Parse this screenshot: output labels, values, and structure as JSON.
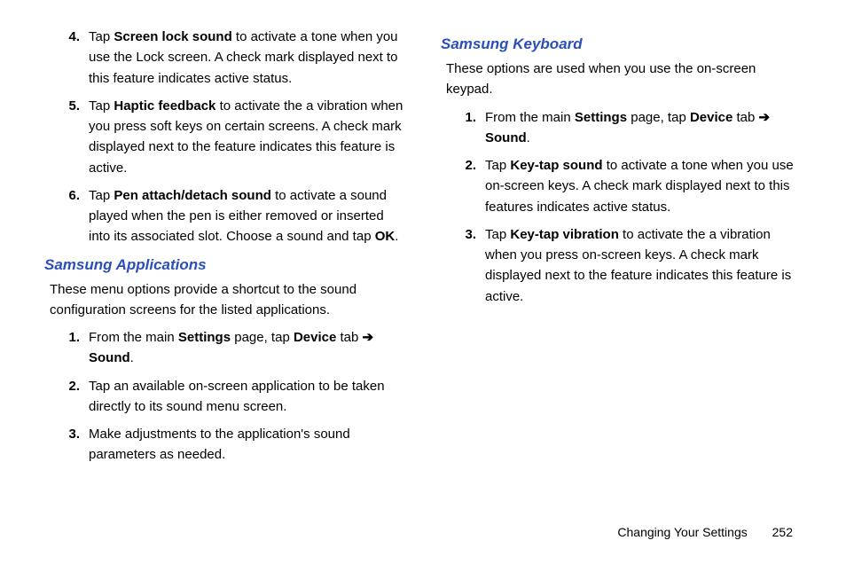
{
  "col1": {
    "items_a": [
      {
        "n": "4.",
        "pre": "Tap ",
        "bold": "Screen lock sound",
        "post": " to activate a tone when you use the Lock screen. A check mark displayed next to this feature indicates active status."
      },
      {
        "n": "5.",
        "pre": "Tap ",
        "bold": "Haptic feedback",
        "post": " to activate the a vibration when you press soft keys on certain screens. A check mark displayed next to the feature indicates this feature is active."
      },
      {
        "n": "6.",
        "pre": "Tap ",
        "bold": "Pen attach/detach sound",
        "post": " to activate a sound played when the pen is either removed or inserted into its associated slot. Choose a sound and tap ",
        "bold2": "OK",
        "post2": "."
      }
    ],
    "section": "Samsung Applications",
    "intro": "These menu options provide a shortcut to the sound configuration screens for the listed applications.",
    "items_b": [
      {
        "n": "1.",
        "text_parts": [
          "From the main ",
          "Settings",
          " page, tap ",
          "Device",
          " tab ",
          "➔",
          " ",
          "Sound",
          "."
        ]
      },
      {
        "n": "2.",
        "plain": "Tap an available on-screen application to be taken directly to its sound menu screen."
      },
      {
        "n": "3.",
        "plain": "Make adjustments to the application's sound parameters as needed."
      }
    ]
  },
  "col2": {
    "section": "Samsung Keyboard",
    "intro": "These options are used when you use the on-screen keypad.",
    "items": [
      {
        "n": "1.",
        "text_parts": [
          "From the main ",
          "Settings",
          " page, tap ",
          "Device",
          " tab ",
          "➔",
          " ",
          "Sound",
          "."
        ]
      },
      {
        "n": "2.",
        "pre": "Tap ",
        "bold": "Key-tap sound",
        "post": " to activate a tone when you use on-screen keys. A check mark displayed next to this features indicates active status."
      },
      {
        "n": "3.",
        "pre": "Tap ",
        "bold": "Key-tap vibration",
        "post": " to activate the a vibration when you press on-screen keys. A check mark displayed next to the feature indicates this feature is active."
      }
    ]
  },
  "footer": {
    "label": "Changing Your Settings",
    "page": "252"
  }
}
